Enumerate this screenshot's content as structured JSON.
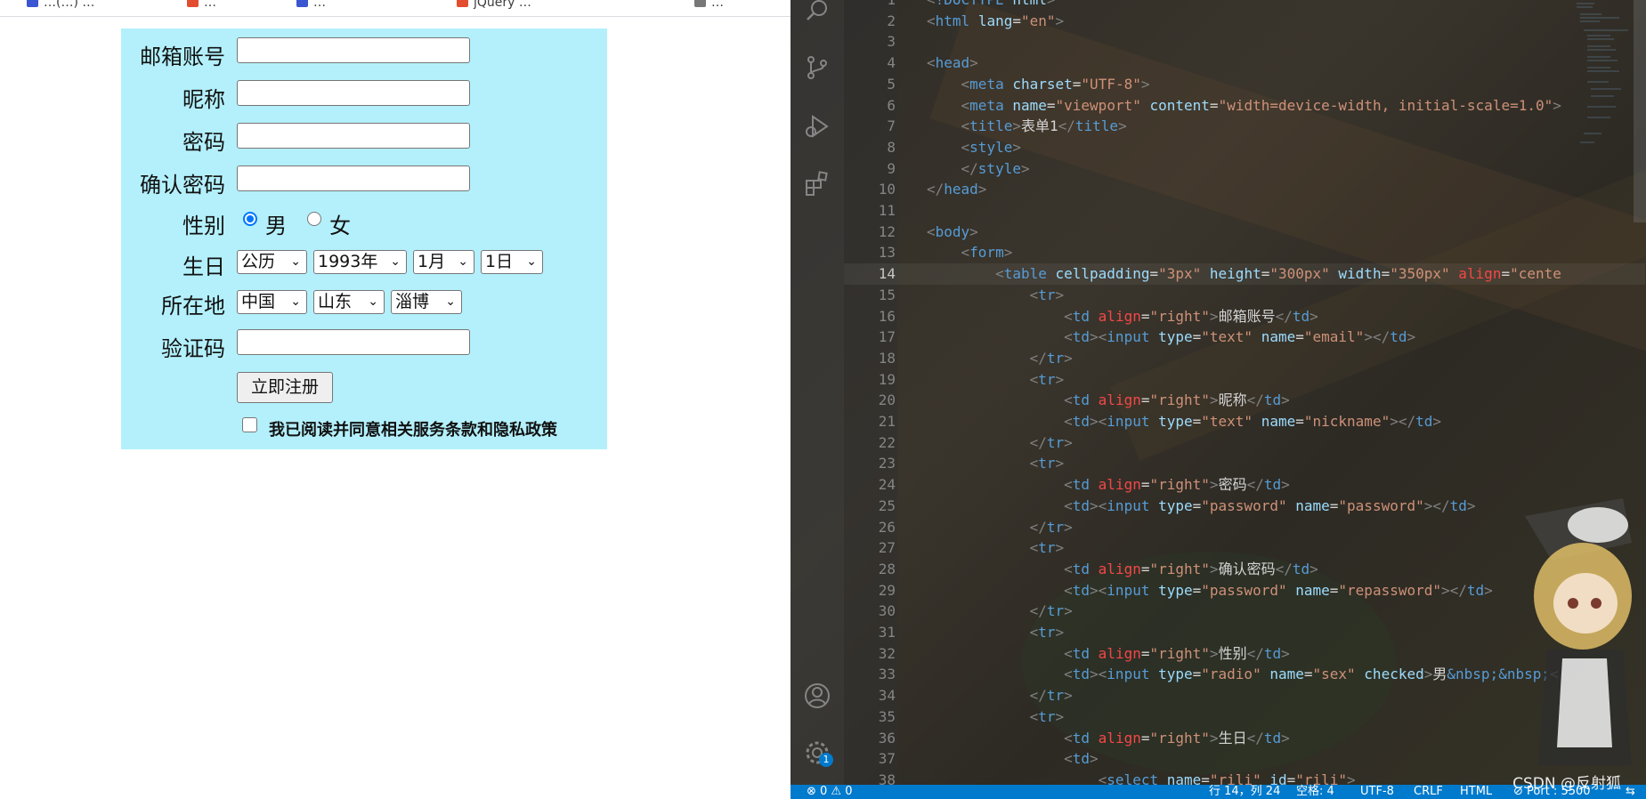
{
  "browser": {
    "bookmarks": [
      {
        "label": "…(…) …",
        "color": "#3a57d1"
      },
      {
        "label": "…",
        "color": "#e34d2f"
      },
      {
        "label": "…",
        "color": "#3a57d1"
      },
      {
        "label": "jQuery …",
        "color": "#e34d2f"
      },
      {
        "label": "…",
        "color": "#777777"
      }
    ],
    "form": {
      "background": "#b3f0fb",
      "email_label": "邮箱账号",
      "nickname_label": "昵称",
      "password_label": "密码",
      "repassword_label": "确认密码",
      "gender_label": "性别",
      "gender_male": "男",
      "gender_female": "女",
      "birthday_label": "生日",
      "calendar_value": "公历",
      "year_value": "1993年",
      "month_value": "1月",
      "day_value": "1日",
      "location_label": "所在地",
      "country_value": "中国",
      "province_value": "山东",
      "city_value": "淄博",
      "captcha_label": "验证码",
      "submit_label": "立即注册",
      "agree_text": "我已阅读并同意相关服务条款和隐私政策"
    }
  },
  "editor": {
    "lines": [
      {
        "n": "1",
        "indent": "",
        "parts": [
          [
            "br",
            "<"
          ],
          [
            "tg",
            "!DOCTYPE "
          ],
          [
            "at",
            "html"
          ],
          [
            "br",
            ">"
          ]
        ]
      },
      {
        "n": "2",
        "indent": "",
        "parts": [
          [
            "br",
            "<"
          ],
          [
            "tg",
            "html "
          ],
          [
            "at",
            "lang"
          ],
          [
            "tx",
            "="
          ],
          [
            "st",
            "\"en\""
          ],
          [
            "br",
            ">"
          ]
        ]
      },
      {
        "n": "3",
        "indent": "",
        "parts": []
      },
      {
        "n": "4",
        "indent": "",
        "parts": [
          [
            "br",
            "<"
          ],
          [
            "tg",
            "head"
          ],
          [
            "br",
            ">"
          ]
        ]
      },
      {
        "n": "5",
        "indent": "    ",
        "parts": [
          [
            "br",
            "<"
          ],
          [
            "tg",
            "meta "
          ],
          [
            "at",
            "charset"
          ],
          [
            "tx",
            "="
          ],
          [
            "st",
            "\"UTF-8\""
          ],
          [
            "br",
            ">"
          ]
        ]
      },
      {
        "n": "6",
        "indent": "    ",
        "parts": [
          [
            "br",
            "<"
          ],
          [
            "tg",
            "meta "
          ],
          [
            "at",
            "name"
          ],
          [
            "tx",
            "="
          ],
          [
            "st",
            "\"viewport\" "
          ],
          [
            "at",
            "content"
          ],
          [
            "tx",
            "="
          ],
          [
            "st",
            "\"width=device-width, initial-scale=1.0\""
          ],
          [
            "br",
            ">"
          ]
        ]
      },
      {
        "n": "7",
        "indent": "    ",
        "parts": [
          [
            "br",
            "<"
          ],
          [
            "tg",
            "title"
          ],
          [
            "br",
            ">"
          ],
          [
            "tx",
            "表单1"
          ],
          [
            "br",
            "</"
          ],
          [
            "tg",
            "title"
          ],
          [
            "br",
            ">"
          ]
        ]
      },
      {
        "n": "8",
        "indent": "    ",
        "parts": [
          [
            "br",
            "<"
          ],
          [
            "tg",
            "style"
          ],
          [
            "br",
            ">"
          ]
        ]
      },
      {
        "n": "9",
        "indent": "    ",
        "parts": [
          [
            "br",
            "</"
          ],
          [
            "tg",
            "style"
          ],
          [
            "br",
            ">"
          ]
        ]
      },
      {
        "n": "10",
        "indent": "",
        "parts": [
          [
            "br",
            "</"
          ],
          [
            "tg",
            "head"
          ],
          [
            "br",
            ">"
          ]
        ]
      },
      {
        "n": "11",
        "indent": "",
        "parts": []
      },
      {
        "n": "12",
        "indent": "",
        "parts": [
          [
            "br",
            "<"
          ],
          [
            "tg",
            "body"
          ],
          [
            "br",
            ">"
          ]
        ]
      },
      {
        "n": "13",
        "indent": "    ",
        "parts": [
          [
            "br",
            "<"
          ],
          [
            "tg",
            "form"
          ],
          [
            "br",
            ">"
          ]
        ]
      },
      {
        "n": "14",
        "indent": "        ",
        "current": true,
        "parts": [
          [
            "br",
            "<"
          ],
          [
            "tg",
            "table "
          ],
          [
            "at",
            "cellpadding"
          ],
          [
            "tx",
            "="
          ],
          [
            "st",
            "\"3px\" "
          ],
          [
            "at",
            "height"
          ],
          [
            "tx",
            "="
          ],
          [
            "st",
            "\"300px\" "
          ],
          [
            "at",
            "width"
          ],
          [
            "tx",
            "="
          ],
          [
            "st",
            "\"350px\" "
          ],
          [
            "at2",
            "align"
          ],
          [
            "tx",
            "="
          ],
          [
            "st",
            "\"cente"
          ]
        ]
      },
      {
        "n": "15",
        "indent": "            ",
        "parts": [
          [
            "br",
            "<"
          ],
          [
            "tg",
            "tr"
          ],
          [
            "br",
            ">"
          ]
        ]
      },
      {
        "n": "16",
        "indent": "                ",
        "parts": [
          [
            "br",
            "<"
          ],
          [
            "tg",
            "td "
          ],
          [
            "at2",
            "align"
          ],
          [
            "tx",
            "="
          ],
          [
            "st",
            "\"right\""
          ],
          [
            "br",
            ">"
          ],
          [
            "tx",
            "邮箱账号"
          ],
          [
            "br",
            "</"
          ],
          [
            "tg",
            "td"
          ],
          [
            "br",
            ">"
          ]
        ]
      },
      {
        "n": "17",
        "indent": "                ",
        "parts": [
          [
            "br",
            "<"
          ],
          [
            "tg",
            "td"
          ],
          [
            "br",
            "><"
          ],
          [
            "tg",
            "input "
          ],
          [
            "at",
            "type"
          ],
          [
            "tx",
            "="
          ],
          [
            "st",
            "\"text\" "
          ],
          [
            "at",
            "name"
          ],
          [
            "tx",
            "="
          ],
          [
            "st",
            "\"email\""
          ],
          [
            "br",
            "></"
          ],
          [
            "tg",
            "td"
          ],
          [
            "br",
            ">"
          ]
        ]
      },
      {
        "n": "18",
        "indent": "            ",
        "parts": [
          [
            "br",
            "</"
          ],
          [
            "tg",
            "tr"
          ],
          [
            "br",
            ">"
          ]
        ]
      },
      {
        "n": "19",
        "indent": "            ",
        "parts": [
          [
            "br",
            "<"
          ],
          [
            "tg",
            "tr"
          ],
          [
            "br",
            ">"
          ]
        ]
      },
      {
        "n": "20",
        "indent": "                ",
        "parts": [
          [
            "br",
            "<"
          ],
          [
            "tg",
            "td "
          ],
          [
            "at2",
            "align"
          ],
          [
            "tx",
            "="
          ],
          [
            "st",
            "\"right\""
          ],
          [
            "br",
            ">"
          ],
          [
            "tx",
            "昵称"
          ],
          [
            "br",
            "</"
          ],
          [
            "tg",
            "td"
          ],
          [
            "br",
            ">"
          ]
        ]
      },
      {
        "n": "21",
        "indent": "                ",
        "parts": [
          [
            "br",
            "<"
          ],
          [
            "tg",
            "td"
          ],
          [
            "br",
            "><"
          ],
          [
            "tg",
            "input "
          ],
          [
            "at",
            "type"
          ],
          [
            "tx",
            "="
          ],
          [
            "st",
            "\"text\" "
          ],
          [
            "at",
            "name"
          ],
          [
            "tx",
            "="
          ],
          [
            "st",
            "\"nickname\""
          ],
          [
            "br",
            "></"
          ],
          [
            "tg",
            "td"
          ],
          [
            "br",
            ">"
          ]
        ]
      },
      {
        "n": "22",
        "indent": "            ",
        "parts": [
          [
            "br",
            "</"
          ],
          [
            "tg",
            "tr"
          ],
          [
            "br",
            ">"
          ]
        ]
      },
      {
        "n": "23",
        "indent": "            ",
        "parts": [
          [
            "br",
            "<"
          ],
          [
            "tg",
            "tr"
          ],
          [
            "br",
            ">"
          ]
        ]
      },
      {
        "n": "24",
        "indent": "                ",
        "parts": [
          [
            "br",
            "<"
          ],
          [
            "tg",
            "td "
          ],
          [
            "at2",
            "align"
          ],
          [
            "tx",
            "="
          ],
          [
            "st",
            "\"right\""
          ],
          [
            "br",
            ">"
          ],
          [
            "tx",
            "密码"
          ],
          [
            "br",
            "</"
          ],
          [
            "tg",
            "td"
          ],
          [
            "br",
            ">"
          ]
        ]
      },
      {
        "n": "25",
        "indent": "                ",
        "parts": [
          [
            "br",
            "<"
          ],
          [
            "tg",
            "td"
          ],
          [
            "br",
            "><"
          ],
          [
            "tg",
            "input "
          ],
          [
            "at",
            "type"
          ],
          [
            "tx",
            "="
          ],
          [
            "st",
            "\"password\" "
          ],
          [
            "at",
            "name"
          ],
          [
            "tx",
            "="
          ],
          [
            "st",
            "\"password\""
          ],
          [
            "br",
            "></"
          ],
          [
            "tg",
            "td"
          ],
          [
            "br",
            ">"
          ]
        ]
      },
      {
        "n": "26",
        "indent": "            ",
        "parts": [
          [
            "br",
            "</"
          ],
          [
            "tg",
            "tr"
          ],
          [
            "br",
            ">"
          ]
        ]
      },
      {
        "n": "27",
        "indent": "            ",
        "parts": [
          [
            "br",
            "<"
          ],
          [
            "tg",
            "tr"
          ],
          [
            "br",
            ">"
          ]
        ]
      },
      {
        "n": "28",
        "indent": "                ",
        "parts": [
          [
            "br",
            "<"
          ],
          [
            "tg",
            "td "
          ],
          [
            "at2",
            "align"
          ],
          [
            "tx",
            "="
          ],
          [
            "st",
            "\"right\""
          ],
          [
            "br",
            ">"
          ],
          [
            "tx",
            "确认密码"
          ],
          [
            "br",
            "</"
          ],
          [
            "tg",
            "td"
          ],
          [
            "br",
            ">"
          ]
        ]
      },
      {
        "n": "29",
        "indent": "                ",
        "parts": [
          [
            "br",
            "<"
          ],
          [
            "tg",
            "td"
          ],
          [
            "br",
            "><"
          ],
          [
            "tg",
            "input "
          ],
          [
            "at",
            "type"
          ],
          [
            "tx",
            "="
          ],
          [
            "st",
            "\"password\" "
          ],
          [
            "at",
            "name"
          ],
          [
            "tx",
            "="
          ],
          [
            "st",
            "\"repassword\""
          ],
          [
            "br",
            "></"
          ],
          [
            "tg",
            "td"
          ],
          [
            "br",
            ">"
          ]
        ]
      },
      {
        "n": "30",
        "indent": "            ",
        "parts": [
          [
            "br",
            "</"
          ],
          [
            "tg",
            "tr"
          ],
          [
            "br",
            ">"
          ]
        ]
      },
      {
        "n": "31",
        "indent": "            ",
        "parts": [
          [
            "br",
            "<"
          ],
          [
            "tg",
            "tr"
          ],
          [
            "br",
            ">"
          ]
        ]
      },
      {
        "n": "32",
        "indent": "                ",
        "parts": [
          [
            "br",
            "<"
          ],
          [
            "tg",
            "td "
          ],
          [
            "at2",
            "align"
          ],
          [
            "tx",
            "="
          ],
          [
            "st",
            "\"right\""
          ],
          [
            "br",
            ">"
          ],
          [
            "tx",
            "性别"
          ],
          [
            "br",
            "</"
          ],
          [
            "tg",
            "td"
          ],
          [
            "br",
            ">"
          ]
        ]
      },
      {
        "n": "33",
        "indent": "                ",
        "parts": [
          [
            "br",
            "<"
          ],
          [
            "tg",
            "td"
          ],
          [
            "br",
            "><"
          ],
          [
            "tg",
            "input "
          ],
          [
            "at",
            "type"
          ],
          [
            "tx",
            "="
          ],
          [
            "st",
            "\"radio\" "
          ],
          [
            "at",
            "name"
          ],
          [
            "tx",
            "="
          ],
          [
            "st",
            "\"sex\" "
          ],
          [
            "at",
            "checked"
          ],
          [
            "br",
            ">"
          ],
          [
            "tx",
            "男"
          ],
          [
            "ent",
            "&nbsp;&nbsp;"
          ],
          [
            "br",
            "<"
          ]
        ]
      },
      {
        "n": "34",
        "indent": "            ",
        "parts": [
          [
            "br",
            "</"
          ],
          [
            "tg",
            "tr"
          ],
          [
            "br",
            ">"
          ]
        ]
      },
      {
        "n": "35",
        "indent": "            ",
        "parts": [
          [
            "br",
            "<"
          ],
          [
            "tg",
            "tr"
          ],
          [
            "br",
            ">"
          ]
        ]
      },
      {
        "n": "36",
        "indent": "                ",
        "parts": [
          [
            "br",
            "<"
          ],
          [
            "tg",
            "td "
          ],
          [
            "at2",
            "align"
          ],
          [
            "tx",
            "="
          ],
          [
            "st",
            "\"right\""
          ],
          [
            "br",
            ">"
          ],
          [
            "tx",
            "生日"
          ],
          [
            "br",
            "</"
          ],
          [
            "tg",
            "td"
          ],
          [
            "br",
            ">"
          ]
        ]
      },
      {
        "n": "37",
        "indent": "                ",
        "parts": [
          [
            "br",
            "<"
          ],
          [
            "tg",
            "td"
          ],
          [
            "br",
            ">"
          ]
        ]
      },
      {
        "n": "38",
        "indent": "                    ",
        "parts": [
          [
            "br",
            "<"
          ],
          [
            "tg",
            "select "
          ],
          [
            "at",
            "name"
          ],
          [
            "tx",
            "="
          ],
          [
            "st",
            "\"rili\" "
          ],
          [
            "at",
            "id"
          ],
          [
            "tx",
            "="
          ],
          [
            "st",
            "\"rili\""
          ],
          [
            "br",
            ">"
          ]
        ]
      }
    ],
    "status": {
      "problems": "⊗ 0 ⚠ 0",
      "cursor": "行 14，列 24",
      "spaces": "空格: 4",
      "encoding": "UTF-8",
      "eol": "CRLF",
      "language": "HTML",
      "port": "⊘ Port : 5500"
    },
    "settings_badge": "1",
    "watermark": "CSDN @反射狐"
  }
}
